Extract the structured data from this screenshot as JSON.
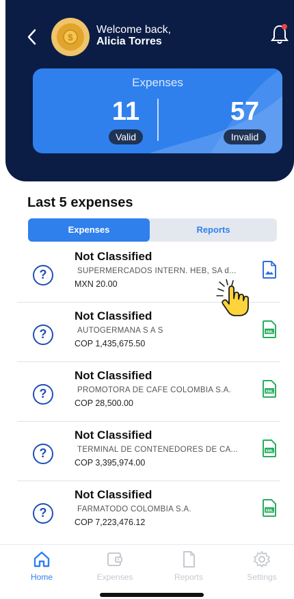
{
  "header": {
    "welcome": "Welcome back,",
    "user_name": "Alicia Torres"
  },
  "stats": {
    "title": "Expenses",
    "valid_count": "11",
    "valid_label": "Valid",
    "invalid_count": "57",
    "invalid_label": "Invalid"
  },
  "section": {
    "title": "Last 5 expenses"
  },
  "segment": {
    "expenses_label": "Expenses",
    "reports_label": "Reports"
  },
  "expenses": [
    {
      "title": "Not Classified",
      "vendor": "SUPERMERCADOS INTERN. HEB, SA d...",
      "amount": "MXN 20.00",
      "doc_icon": "image-document-icon"
    },
    {
      "title": "Not Classified",
      "vendor": "AUTOGERMANA S A S",
      "amount": "COP 1,435,675.50",
      "doc_icon": "xml-document-icon"
    },
    {
      "title": "Not Classified",
      "vendor": "PROMOTORA DE CAFE COLOMBIA S.A.",
      "amount": "COP 28,500.00",
      "doc_icon": "xml-document-icon"
    },
    {
      "title": "Not Classified",
      "vendor": "TERMINAL DE CONTENEDORES DE CA...",
      "amount": "COP 3,395,974.00",
      "doc_icon": "xml-document-icon"
    },
    {
      "title": "Not Classified",
      "vendor": "FARMATODO COLOMBIA S.A.",
      "amount": "COP 7,223,476.12",
      "doc_icon": "xml-document-icon"
    }
  ],
  "tabbar": {
    "home": "Home",
    "expenses": "Expenses",
    "reports": "Reports",
    "settings": "Settings"
  },
  "colors": {
    "header_bg": "#0b1d45",
    "accent": "#2f80ed",
    "xml_green": "#27ae60"
  }
}
